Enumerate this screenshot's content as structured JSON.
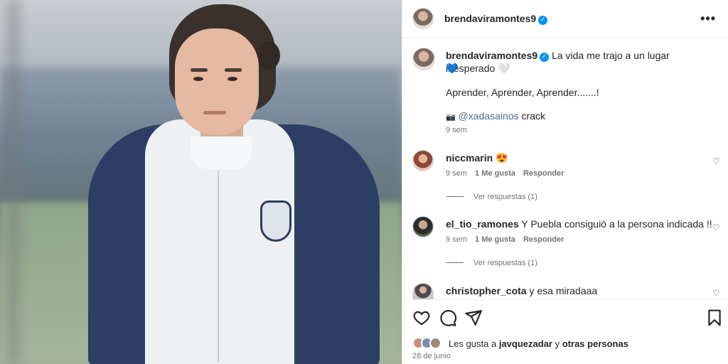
{
  "post": {
    "username": "brendaviramontes9",
    "verified_badge": "✓",
    "more_icon": "more-horizontal-icon",
    "caption_line1": "La vida me trajo a un lugar inesperado 🤍",
    "caption_line2": "💙",
    "caption_para2": "Aprender, Aprender, Aprender.......!",
    "caption_camera": "📷",
    "caption_mention": "@xadasainos",
    "caption_after_mention": "crack",
    "time_ago": "9 sem"
  },
  "comments": [
    {
      "username": "niccmarin",
      "text": "😍",
      "time": "9 sem",
      "likes": "1 Me gusta",
      "reply_label": "Responder",
      "view_replies": "Ver respuestas (1)"
    },
    {
      "username": "el_tio_ramones",
      "text": "Y Puebla consiguió a la persona indicada !!",
      "time": "9 sem",
      "likes": "1 Me gusta",
      "reply_label": "Responder",
      "view_replies": "Ver respuestas (1)"
    },
    {
      "username": "christopher_cota",
      "text": "y esa miradaaa"
    }
  ],
  "likes": {
    "prefix": "Les gusta a",
    "user": "javquezadar",
    "conjunction": "y",
    "others": "otras personas"
  },
  "date": "28 de junio",
  "colors": {
    "verified": "#0095f6",
    "meta": "#737373",
    "mention": "#4e6ba0"
  }
}
